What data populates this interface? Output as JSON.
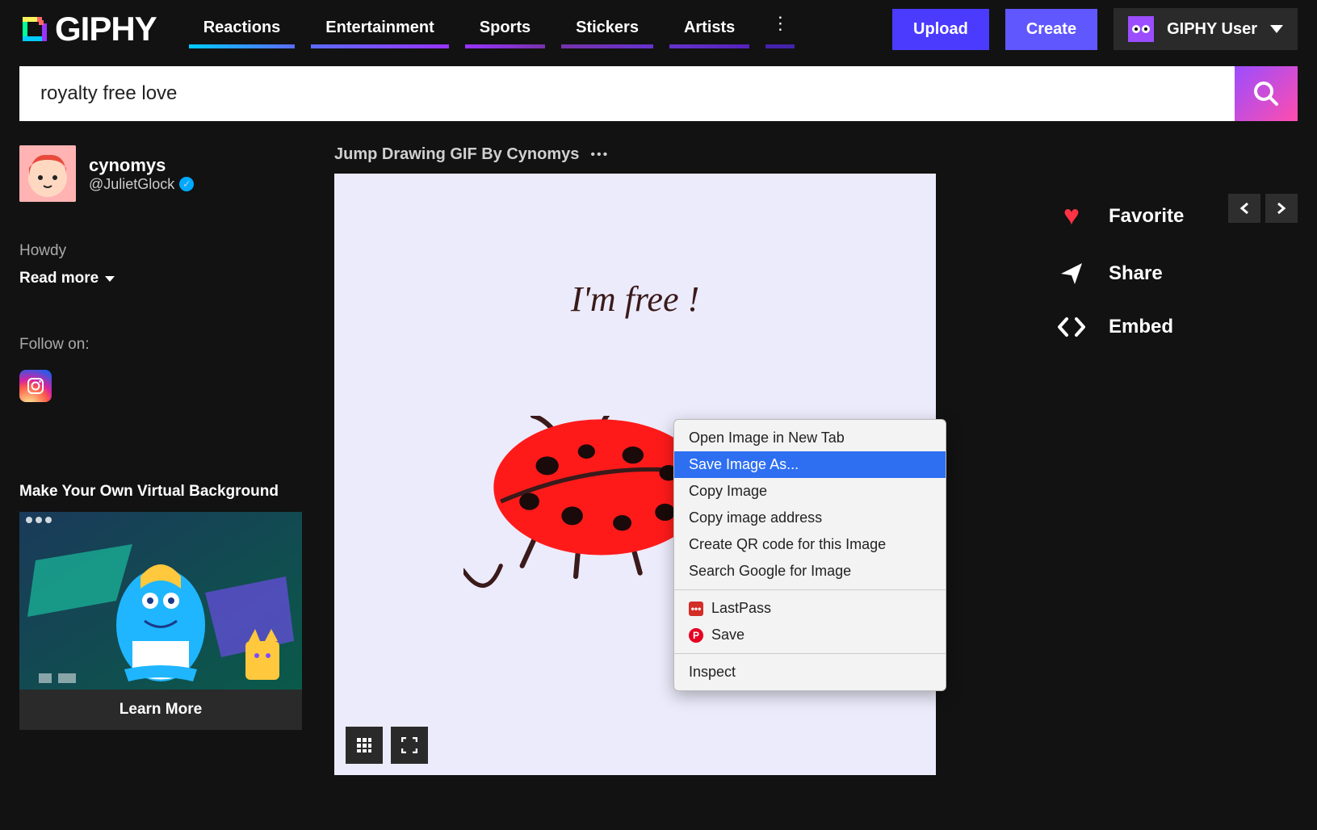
{
  "header": {
    "brand": "GIPHY",
    "nav": [
      "Reactions",
      "Entertainment",
      "Sports",
      "Stickers",
      "Artists"
    ],
    "upload": "Upload",
    "create": "Create",
    "user": "GIPHY User"
  },
  "search": {
    "value": "royalty free love"
  },
  "profile": {
    "display_name": "cynomys",
    "handle": "@JulietGlock",
    "greeting": "Howdy",
    "read_more": "Read more",
    "follow_on": "Follow on:"
  },
  "promo": {
    "title": "Make Your Own Virtual Background",
    "cta": "Learn More"
  },
  "gif": {
    "title": "Jump Drawing GIF By Cynomys",
    "caption": "I'm free !"
  },
  "actions": {
    "favorite": "Favorite",
    "share": "Share",
    "embed": "Embed"
  },
  "context_menu": {
    "items": [
      "Open Image in New Tab",
      "Save Image As...",
      "Copy Image",
      "Copy image address",
      "Create QR code for this Image",
      "Search Google for Image"
    ],
    "lastpass": "LastPass",
    "save": "Save",
    "inspect": "Inspect"
  }
}
